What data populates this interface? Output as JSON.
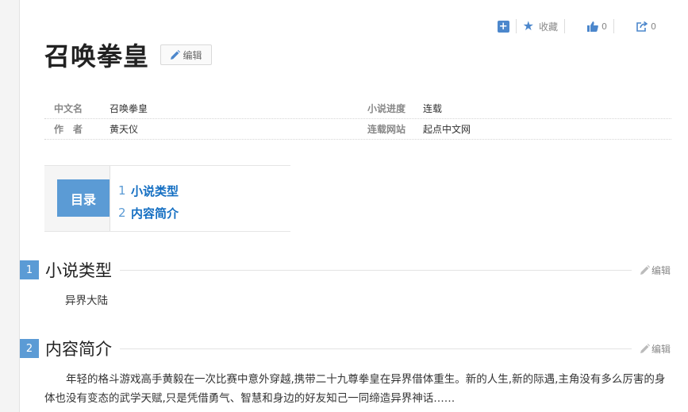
{
  "actions": {
    "favorite_label": "收藏",
    "like_count": "0",
    "share_count": "0"
  },
  "title": "召唤拳皇",
  "edit_label": "编辑",
  "info": {
    "row1": {
      "label_a": "中文名",
      "value_a": "召唤拳皇",
      "label_b": "小说进度",
      "value_b": "连载"
    },
    "row2": {
      "label_a": "作　者",
      "value_a": "黄天仪",
      "label_b": "连载网站",
      "value_b": "起点中文网"
    }
  },
  "toc": {
    "heading": "目录",
    "items": [
      {
        "num": "1",
        "label": "小说类型"
      },
      {
        "num": "2",
        "label": "内容简介"
      }
    ]
  },
  "sections": [
    {
      "num": "1",
      "title": "小说类型",
      "edit": "编辑",
      "body": "异界大陆"
    },
    {
      "num": "2",
      "title": "内容简介",
      "edit": "编辑",
      "body": "　　年轻的格斗游戏高手黄毅在一次比赛中意外穿越,携带二十九尊拳皇在异界借体重生。新的人生,新的际遇,主角没有多么厉害的身体也没有变态的武学天赋,只是凭借勇气、智慧和身边的好友知己一同缔造异界神话……"
    }
  ],
  "colors": {
    "accent": "#5b9bd5",
    "link": "#136ec2"
  }
}
